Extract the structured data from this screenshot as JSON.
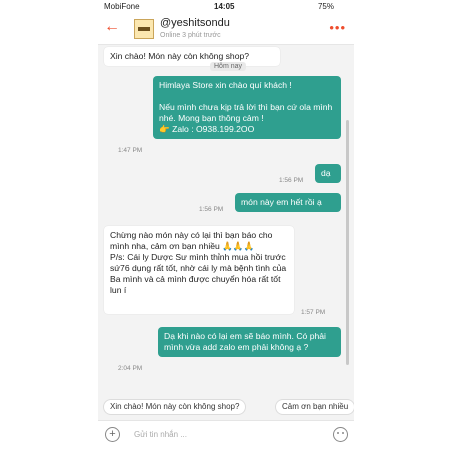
{
  "status": {
    "carrier": "MobiFone",
    "time": "14:05",
    "battery": "75%"
  },
  "header": {
    "shop_name": "@yeshitsondu",
    "status": "Online 3 phút trước"
  },
  "messages": [
    {
      "side": "in",
      "text": "Xin chào! Món này còn không shop?"
    },
    {
      "day": "Hôm nay"
    },
    {
      "side": "out",
      "text": "Himlaya Store xin chào quí khách !\n\nNếu mình chưa kịp trả lời thì bạn cứ ola mình nhé. Mong bạn thông cảm !\n👉 Zalo : O938.199.2OO",
      "time": "1:47 PM"
    },
    {
      "side": "out",
      "text": "dạ",
      "time": "1:56 PM"
    },
    {
      "side": "out",
      "text": "món này em hết rồi ạ",
      "time": "1:56 PM"
    },
    {
      "side": "in",
      "text": "Chừng nào món này có lại thì bạn báo cho mình nha, cảm ơn bạn nhiều 🙏🙏🙏\nP/s: Cái ly Dược Sư mình thỉnh mua hồi trước sứ76 dụng rất tốt, nhờ cái ly mà bệnh tình của Ba mình và cả mình được chuyển hóa rất tốt lun í",
      "time": "1:57 PM"
    },
    {
      "side": "out",
      "text": "Dạ khi nào có lại em sẽ báo mình. Có phải mình vừa add zalo em phải không ạ ?",
      "time": "2:04 PM"
    }
  ],
  "quick_replies": [
    "Xin chào! Món này còn không shop?",
    "Cảm ơn bạn nhiều"
  ],
  "input": {
    "placeholder": "Gửi tin nhắn ..."
  },
  "colors": {
    "accent": "#ee4d2d",
    "outgoing": "#2f9f8f",
    "incoming": "#ffffff"
  },
  "icons": [
    "back-arrow-icon",
    "shop-avatar-icon",
    "more-icon",
    "plus-icon",
    "emoji-icon",
    "wifi-icon",
    "battery-icon"
  ]
}
